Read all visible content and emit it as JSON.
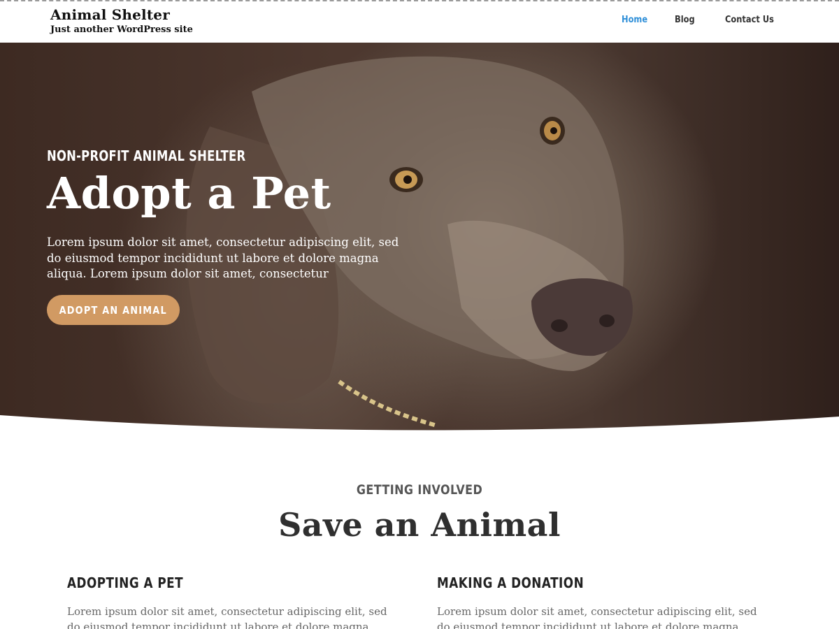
{
  "header": {
    "site_title": "Animal Shelter",
    "tagline": "Just another WordPress site",
    "nav": [
      {
        "label": "Home",
        "active": true
      },
      {
        "label": "Blog",
        "active": false
      },
      {
        "label": "Contact Us",
        "active": false
      }
    ]
  },
  "hero": {
    "eyebrow": "NON-PROFIT ANIMAL SHELTER",
    "title": "Adopt a Pet",
    "text": "Lorem ipsum dolor sit amet, consectetur adipiscing elit, sed do eiusmod tempor incididunt ut labore et dolore magna aliqua. Lorem ipsum dolor sit amet, consectetur",
    "button_label": "ADOPT AN ANIMAL"
  },
  "section": {
    "eyebrow": "GETTING INVOLVED",
    "title": "Save an Animal",
    "cards": [
      {
        "heading": "ADOPTING A PET",
        "text": "Lorem ipsum dolor sit amet, consectetur adipiscing elit, sed do eiusmod tempor incididunt ut labore et dolore magna aliqua. Ut"
      },
      {
        "heading": "MAKING A DONATION",
        "text": "Lorem ipsum dolor sit amet, consectetur adipiscing elit, sed do eiusmod tempor incididunt ut labore et dolore magna aliqua. Ut"
      }
    ]
  },
  "colors": {
    "nav_active": "#2f8fd8",
    "nav_default": "#333333",
    "button": "#d19a63"
  }
}
